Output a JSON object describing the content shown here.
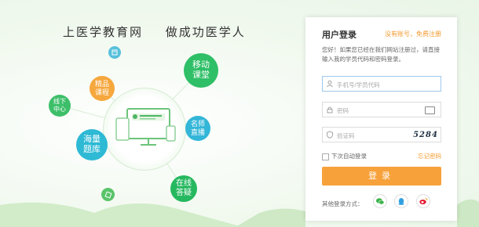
{
  "slogan": {
    "part1": "上医学教育网",
    "part2": "做成功医学人"
  },
  "bubbles": {
    "yidong": [
      "移动",
      "课堂"
    ],
    "jingpin": [
      "精品",
      "课程"
    ],
    "xianxia": [
      "线下",
      "中心"
    ],
    "haitiku": [
      "海量",
      "题库"
    ],
    "mingshi": [
      "名师",
      "直播"
    ],
    "zaixian": [
      "在线",
      "答疑"
    ]
  },
  "login": {
    "title": "用户登录",
    "register_link": "没有账号，免费注册",
    "description": "您好！如果您已经在我们网站注册过，请直接输入我的学员代码和密码登录。",
    "username_placeholder": "手机号/学员代码",
    "password_placeholder": "密码",
    "captcha_placeholder": "验证码",
    "captcha_value": "5284",
    "remember_label": "下次自动登录",
    "forgot_link": "忘记密码",
    "submit_label": "登录",
    "other_login_label": "其他登录方式："
  },
  "colors": {
    "accent": "#f7a13a",
    "green": "#2fbf67",
    "blue": "#2eb9d5"
  }
}
